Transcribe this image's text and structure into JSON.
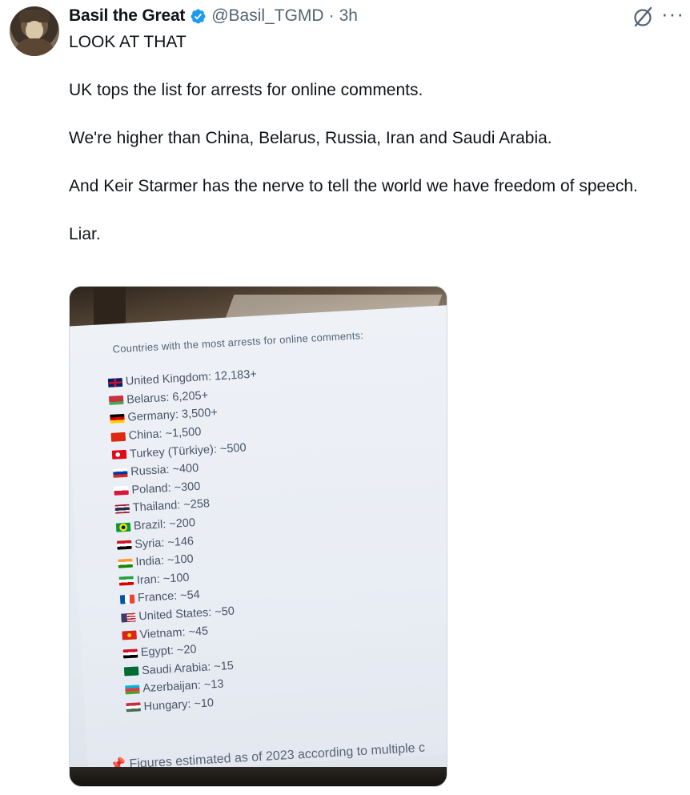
{
  "author": {
    "display_name": "Basil the Great",
    "handle": "@Basil_TGMD",
    "separator": "·",
    "time": "3h",
    "verified_color": "#1d9bf0"
  },
  "tweet": {
    "paragraphs": [
      "LOOK AT THAT",
      "UK tops the list for arrests for online comments.",
      "We're higher than China, Belarus, Russia, Iran and Saudi Arabia.",
      "And Keir Starmer has the nerve to tell the world we have freedom of speech.",
      "Liar."
    ]
  },
  "icons": {
    "grok": "grok-icon",
    "more": "more-icon",
    "more_glyph": "···"
  },
  "media": {
    "slide_title": "Countries with the most arrests for online comments:",
    "rows": [
      {
        "text": "United Kingdom: 12,183+",
        "flag": "uk"
      },
      {
        "text": "Belarus: 6,205+",
        "flag": "belarus"
      },
      {
        "text": "Germany: 3,500+",
        "flag": "germany"
      },
      {
        "text": "China: ~1,500",
        "flag": "china"
      },
      {
        "text": "Turkey (Türkiye): ~500",
        "flag": "turkey"
      },
      {
        "text": "Russia: ~400",
        "flag": "russia"
      },
      {
        "text": "Poland: ~300",
        "flag": "poland"
      },
      {
        "text": "Thailand: ~258",
        "flag": "thailand"
      },
      {
        "text": "Brazil: ~200",
        "flag": "brazil"
      },
      {
        "text": "Syria: ~146",
        "flag": "syria"
      },
      {
        "text": "India: ~100",
        "flag": "india"
      },
      {
        "text": "Iran: ~100",
        "flag": "iran"
      },
      {
        "text": "France: ~54",
        "flag": "france"
      },
      {
        "text": "United States: ~50",
        "flag": "usa"
      },
      {
        "text": "Vietnam: ~45",
        "flag": "vietnam"
      },
      {
        "text": "Egypt: ~20",
        "flag": "egypt"
      },
      {
        "text": "Saudi Arabia: ~15",
        "flag": "saudi"
      },
      {
        "text": "Azerbaijan: ~13",
        "flag": "azerbaijan"
      },
      {
        "text": "Hungary: ~10",
        "flag": "hungary"
      }
    ],
    "footnote": "Figures estimated as of 2023 according to multiple c",
    "pin_glyph": "📌"
  }
}
